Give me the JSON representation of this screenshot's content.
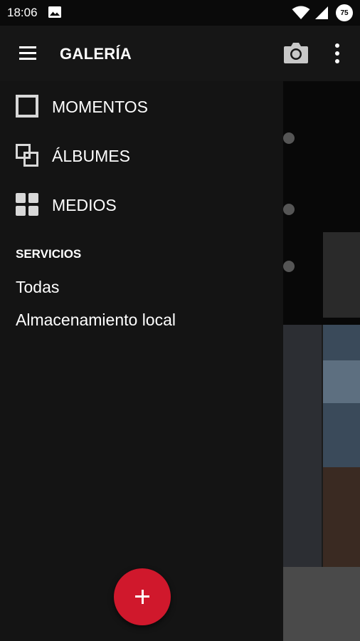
{
  "status_bar": {
    "time": "18:06",
    "battery_level": "75",
    "icons": [
      "image-notification-icon",
      "wifi-icon",
      "signal-icon",
      "battery-icon"
    ]
  },
  "app_bar": {
    "title": "GALERÍA",
    "icons": [
      "menu-icon",
      "camera-icon",
      "more-vert-icon"
    ]
  },
  "drawer": {
    "nav_items": [
      {
        "label": "MOMENTOS",
        "icon": "square-outline-icon"
      },
      {
        "label": "ÁLBUMES",
        "icon": "albums-icon"
      },
      {
        "label": "MEDIOS",
        "icon": "grid-icon"
      }
    ],
    "section_header": "SERVICIOS",
    "services": [
      {
        "label": "Todas"
      },
      {
        "label": "Almacenamiento local"
      }
    ]
  },
  "fab": {
    "icon": "plus-icon"
  },
  "colors": {
    "drawer_bg": "#141414",
    "appbar_bg": "#161616",
    "accent": "#d0182c"
  }
}
